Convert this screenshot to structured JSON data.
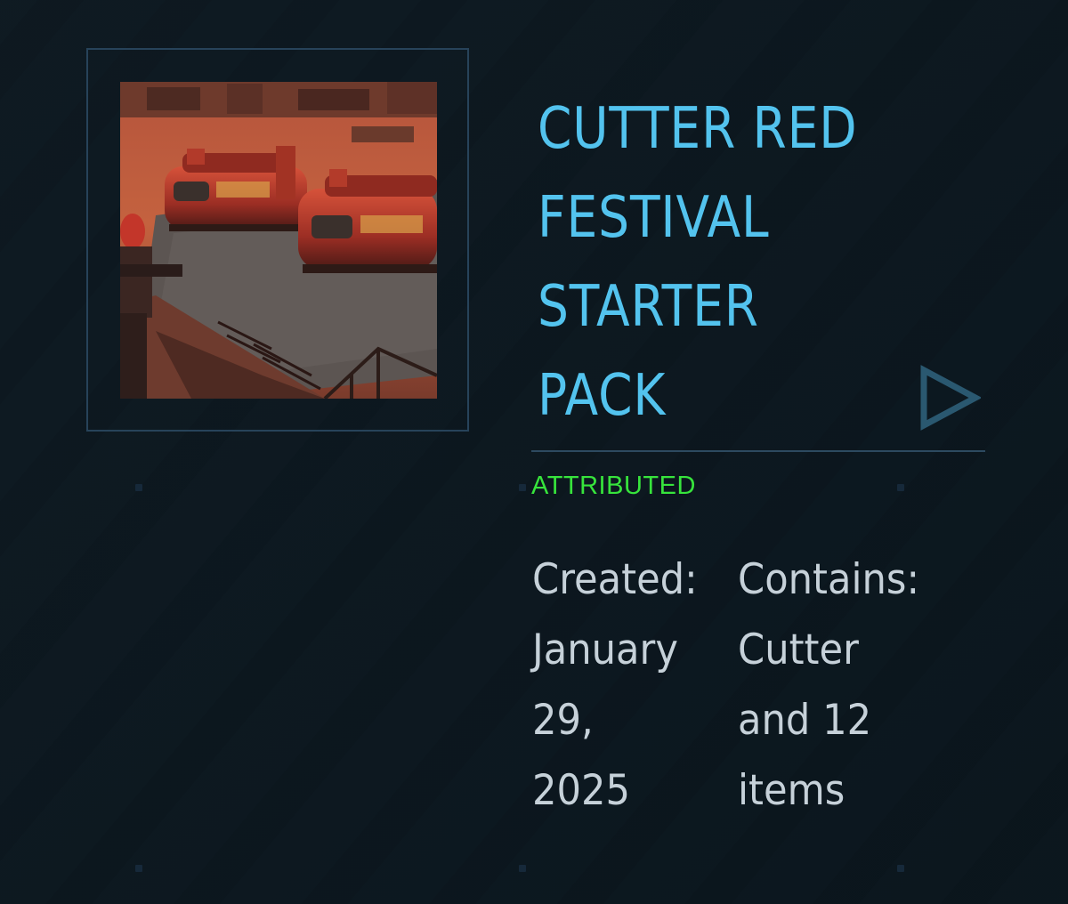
{
  "item": {
    "title_lines": [
      "CUTTER RED",
      "FESTIVAL",
      "STARTER",
      "PACK"
    ],
    "status": "ATTRIBUTED",
    "status_color": "#37e43c",
    "accent_color": "#53c3ee",
    "thumbnail": "cutter-red-festival-ships-image",
    "action_icon": "play-triangle-icon",
    "created": {
      "label": "Created:",
      "value_lines": [
        "January",
        "29,",
        "2025"
      ]
    },
    "contains": {
      "label": "Contains:",
      "value_lines": [
        "Cutter",
        "and 12",
        "items"
      ]
    }
  }
}
